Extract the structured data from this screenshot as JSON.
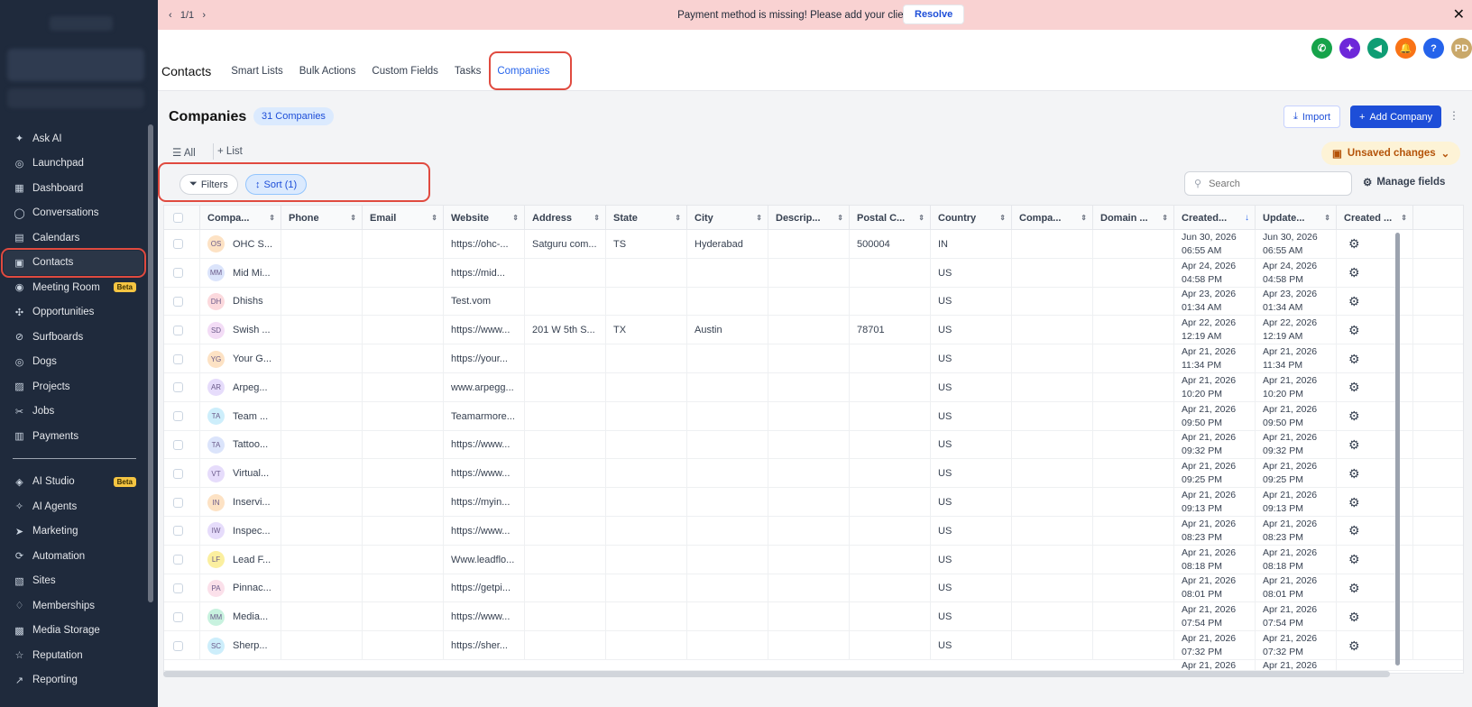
{
  "banner": {
    "pager": "1/1",
    "message": "Payment method is missing! Please add your client's card.",
    "resolve_label": "Resolve"
  },
  "sidebar": {
    "items": [
      {
        "label": "Ask AI",
        "icon": "sparkle-icon"
      },
      {
        "label": "Launchpad",
        "icon": "rocket-icon"
      },
      {
        "label": "Dashboard",
        "icon": "dashboard-icon"
      },
      {
        "label": "Conversations",
        "icon": "chat-icon"
      },
      {
        "label": "Calendars",
        "icon": "calendar-icon"
      },
      {
        "label": "Contacts",
        "icon": "contacts-icon",
        "active": true
      },
      {
        "label": "Meeting Room",
        "icon": "meeting-icon",
        "badge": "Beta"
      },
      {
        "label": "Opportunities",
        "icon": "opportunities-icon"
      },
      {
        "label": "Surfboards",
        "icon": "surfboard-icon"
      },
      {
        "label": "Dogs",
        "icon": "dog-icon"
      },
      {
        "label": "Projects",
        "icon": "projects-icon"
      },
      {
        "label": "Jobs",
        "icon": "jobs-icon"
      },
      {
        "label": "Payments",
        "icon": "payments-icon"
      }
    ],
    "items2": [
      {
        "label": "AI Studio",
        "icon": "ai-studio-icon",
        "badge": "Beta"
      },
      {
        "label": "AI Agents",
        "icon": "ai-agents-icon"
      },
      {
        "label": "Marketing",
        "icon": "marketing-icon"
      },
      {
        "label": "Automation",
        "icon": "automation-icon"
      },
      {
        "label": "Sites",
        "icon": "sites-icon"
      },
      {
        "label": "Memberships",
        "icon": "memberships-icon"
      },
      {
        "label": "Media Storage",
        "icon": "media-icon"
      },
      {
        "label": "Reputation",
        "icon": "star-icon"
      },
      {
        "label": "Reporting",
        "icon": "reporting-icon"
      }
    ]
  },
  "header": {
    "title": "Contacts",
    "tabs": [
      "Smart Lists",
      "Bulk Actions",
      "Custom Fields",
      "Tasks",
      "Companies"
    ],
    "active_tab": "Companies",
    "avatar_initials": "PD",
    "help_label": "?",
    "icon_colors": [
      "#16a34a",
      "#6d28d9",
      "#0f9d74",
      "#f97316",
      "#2563eb",
      "#c9a86a"
    ]
  },
  "page": {
    "title": "Companies",
    "count_badge": "31 Companies",
    "import_label": "Import",
    "add_label": "Add Company",
    "view_all": "All",
    "view_add": "List",
    "unsaved_label": "Unsaved changes",
    "filters_label": "Filters",
    "sort_label": "Sort (1)",
    "search_placeholder": "Search",
    "manage_fields_label": "Manage fields"
  },
  "table": {
    "columns": [
      "Compa...",
      "Phone",
      "Email",
      "Website",
      "Address",
      "State",
      "City",
      "Descrip...",
      "Postal C...",
      "Country",
      "Compa...",
      "Domain ...",
      "Created...",
      "Update...",
      "Created ..."
    ],
    "rows": [
      {
        "initials": "OS",
        "color": "#fde2c4",
        "name": "OHC S...",
        "website": "https://ohc-...",
        "address": "Satguru com...",
        "state": "TS",
        "city": "Hyderabad",
        "postal": "500004",
        "country": "IN",
        "created_date": "Jun 30, 2026",
        "created_time": "06:55 AM",
        "updated_date": "Jun 30, 2026",
        "updated_time": "06:55 AM"
      },
      {
        "initials": "MM",
        "color": "#dbe4fb",
        "name": "Mid Mi...",
        "website": "https://mid...",
        "address": "",
        "state": "",
        "city": "",
        "postal": "",
        "country": "US",
        "created_date": "Apr 24, 2026",
        "created_time": "04:58 PM",
        "updated_date": "Apr 24, 2026",
        "updated_time": "04:58 PM"
      },
      {
        "initials": "DH",
        "color": "#fcd9dd",
        "name": "Dhishs",
        "website": "Test.vom",
        "address": "",
        "state": "",
        "city": "",
        "postal": "",
        "country": "US",
        "created_date": "Apr 23, 2026",
        "created_time": "01:34 AM",
        "updated_date": "Apr 23, 2026",
        "updated_time": "01:34 AM"
      },
      {
        "initials": "SD",
        "color": "#f3dcf6",
        "name": "Swish ...",
        "website": "https://www...",
        "address": "201 W 5th S...",
        "state": "TX",
        "city": "Austin",
        "postal": "78701",
        "country": "US",
        "created_date": "Apr 22, 2026",
        "created_time": "12:19 AM",
        "updated_date": "Apr 22, 2026",
        "updated_time": "12:19 AM"
      },
      {
        "initials": "YG",
        "color": "#fde2c4",
        "name": "Your G...",
        "website": "https://your...",
        "address": "",
        "state": "",
        "city": "",
        "postal": "",
        "country": "US",
        "created_date": "Apr 21, 2026",
        "created_time": "11:34 PM",
        "updated_date": "Apr 21, 2026",
        "updated_time": "11:34 PM"
      },
      {
        "initials": "AR",
        "color": "#e6dcfb",
        "name": "Arpeg...",
        "website": "www.arpegg...",
        "address": "",
        "state": "",
        "city": "",
        "postal": "",
        "country": "US",
        "created_date": "Apr 21, 2026",
        "created_time": "10:20 PM",
        "updated_date": "Apr 21, 2026",
        "updated_time": "10:20 PM"
      },
      {
        "initials": "TA",
        "color": "#cdeefb",
        "name": "Team ...",
        "website": "Teamarmore...",
        "address": "",
        "state": "",
        "city": "",
        "postal": "",
        "country": "US",
        "created_date": "Apr 21, 2026",
        "created_time": "09:50 PM",
        "updated_date": "Apr 21, 2026",
        "updated_time": "09:50 PM"
      },
      {
        "initials": "TA",
        "color": "#dbe4fb",
        "name": "Tattoo...",
        "website": "https://www...",
        "address": "",
        "state": "",
        "city": "",
        "postal": "",
        "country": "US",
        "created_date": "Apr 21, 2026",
        "created_time": "09:32 PM",
        "updated_date": "Apr 21, 2026",
        "updated_time": "09:32 PM"
      },
      {
        "initials": "VT",
        "color": "#e6dcfb",
        "name": "Virtual...",
        "website": "https://www...",
        "address": "",
        "state": "",
        "city": "",
        "postal": "",
        "country": "US",
        "created_date": "Apr 21, 2026",
        "created_time": "09:25 PM",
        "updated_date": "Apr 21, 2026",
        "updated_time": "09:25 PM"
      },
      {
        "initials": "IN",
        "color": "#fde2c4",
        "name": "Inservi...",
        "website": "https://myin...",
        "address": "",
        "state": "",
        "city": "",
        "postal": "",
        "country": "US",
        "created_date": "Apr 21, 2026",
        "created_time": "09:13 PM",
        "updated_date": "Apr 21, 2026",
        "updated_time": "09:13 PM"
      },
      {
        "initials": "IW",
        "color": "#e6dcfb",
        "name": "Inspec...",
        "website": "https://www...",
        "address": "",
        "state": "",
        "city": "",
        "postal": "",
        "country": "US",
        "created_date": "Apr 21, 2026",
        "created_time": "08:23 PM",
        "updated_date": "Apr 21, 2026",
        "updated_time": "08:23 PM"
      },
      {
        "initials": "LF",
        "color": "#fbef9f",
        "name": "Lead F...",
        "website": "Www.leadflo...",
        "address": "",
        "state": "",
        "city": "",
        "postal": "",
        "country": "US",
        "created_date": "Apr 21, 2026",
        "created_time": "08:18 PM",
        "updated_date": "Apr 21, 2026",
        "updated_time": "08:18 PM"
      },
      {
        "initials": "PA",
        "color": "#fbe0ea",
        "name": "Pinnac...",
        "website": "https://getpi...",
        "address": "",
        "state": "",
        "city": "",
        "postal": "",
        "country": "US",
        "created_date": "Apr 21, 2026",
        "created_time": "08:01 PM",
        "updated_date": "Apr 21, 2026",
        "updated_time": "08:01 PM"
      },
      {
        "initials": "MM",
        "color": "#c8f2df",
        "name": "Media...",
        "website": "https://www...",
        "address": "",
        "state": "",
        "city": "",
        "postal": "",
        "country": "US",
        "created_date": "Apr 21, 2026",
        "created_time": "07:54 PM",
        "updated_date": "Apr 21, 2026",
        "updated_time": "07:54 PM"
      },
      {
        "initials": "SC",
        "color": "#cdeefb",
        "name": "Sherp...",
        "website": "https://sher...",
        "address": "",
        "state": "",
        "city": "",
        "postal": "",
        "country": "US",
        "created_date": "Apr 21, 2026",
        "created_time": "07:32 PM",
        "updated_date": "Apr 21, 2026",
        "updated_time": "07:32 PM"
      }
    ],
    "last_row_partial": {
      "created_date": "Apr 21, 2026",
      "updated_date": "Apr 21, 2026"
    }
  }
}
